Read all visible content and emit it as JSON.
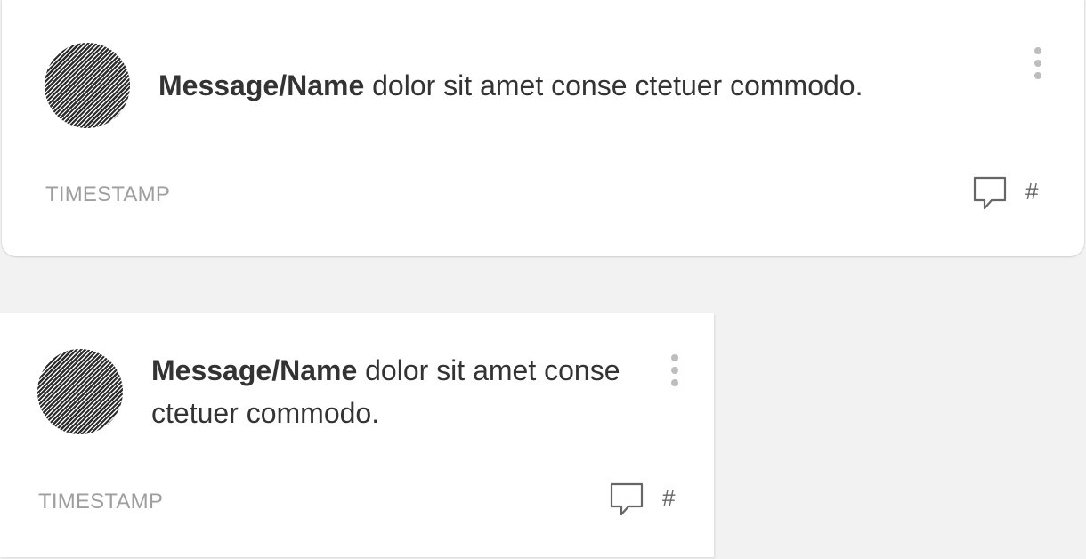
{
  "cards": [
    {
      "name": "Message/Name",
      "message": " dolor sit amet conse ctetuer commodo.",
      "timestamp": "TIMESTAMP",
      "hash": "#",
      "comment_icon": "speech-bubble-icon",
      "menu_icon": "vertical-dots-icon"
    },
    {
      "name": "Message/Name",
      "message": " dolor sit amet conse ctetuer commodo.",
      "timestamp": "TIMESTAMP",
      "hash": "#",
      "comment_icon": "speech-bubble-icon",
      "menu_icon": "vertical-dots-icon"
    }
  ],
  "colors": {
    "background": "#f2f2f2",
    "card": "#ffffff",
    "text": "#333333",
    "muted": "#9e9e9e",
    "icon": "#666666",
    "menu_dots": "#bdbdbd",
    "avatar": "#2d2d2d"
  }
}
